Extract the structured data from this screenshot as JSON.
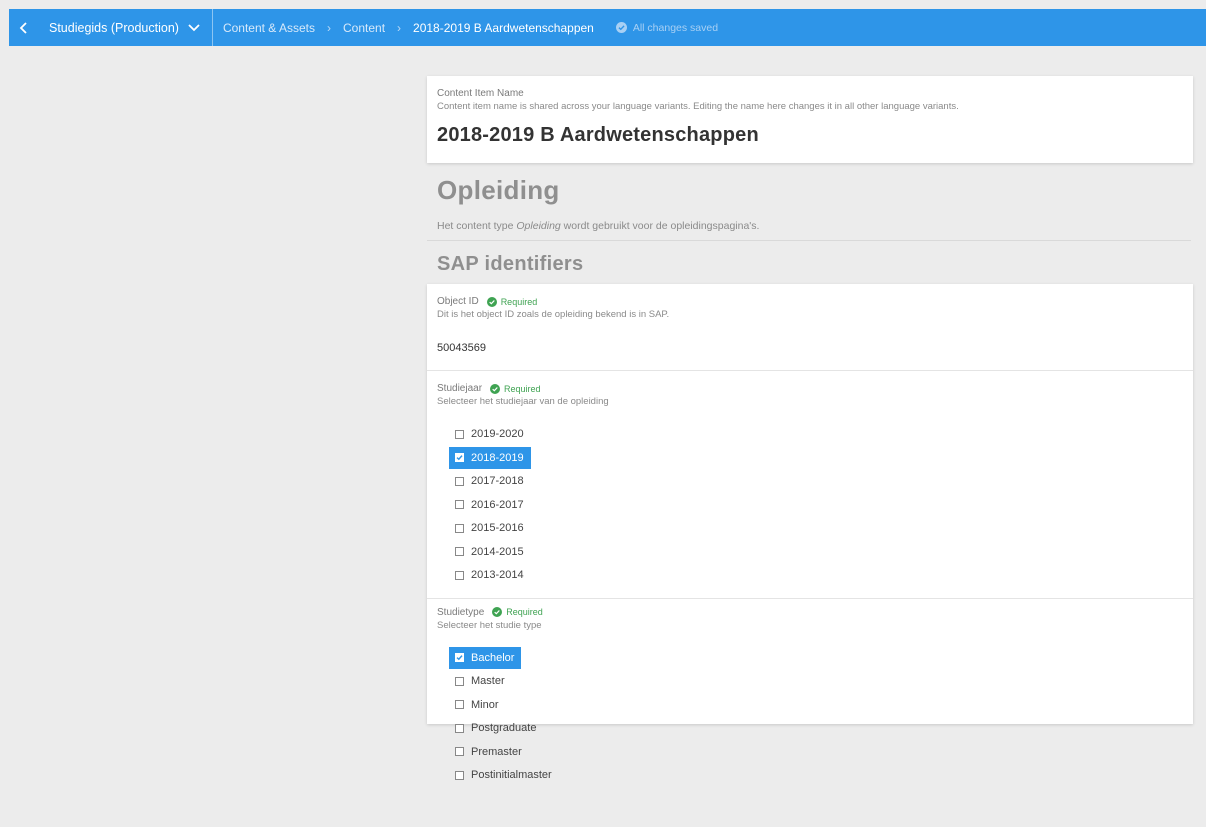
{
  "topbar": {
    "project_label": "Studiegids (Production)",
    "breadcrumbs": [
      "Content & Assets",
      "Content",
      "2018-2019 B Aardwetenschappen"
    ],
    "status": "All changes saved"
  },
  "name_card": {
    "label": "Content Item Name",
    "hint": "Content item name is shared across your language variants. Editing the name here changes it in all other language variants.",
    "value": "2018-2019 B Aardwetenschappen"
  },
  "content_type": {
    "title": "Opleiding",
    "desc_prefix": "Het content type ",
    "desc_type": "Opleiding",
    "desc_suffix": " wordt gebruikt voor de opleidingspagina's."
  },
  "group": {
    "title": "SAP identifiers"
  },
  "required_label": "Required",
  "fields": {
    "object_id": {
      "label": "Object ID",
      "hint": "Dit is het object ID zoals de opleiding bekend is in SAP.",
      "value": "50043569"
    },
    "studiejaar": {
      "label": "Studiejaar",
      "hint": "Selecteer het studiejaar van de opleiding",
      "options": [
        {
          "label": "2019-2020",
          "selected": false
        },
        {
          "label": "2018-2019",
          "selected": true
        },
        {
          "label": "2017-2018",
          "selected": false
        },
        {
          "label": "2016-2017",
          "selected": false
        },
        {
          "label": "2015-2016",
          "selected": false
        },
        {
          "label": "2014-2015",
          "selected": false
        },
        {
          "label": "2013-2014",
          "selected": false
        }
      ]
    },
    "studietype": {
      "label": "Studietype",
      "hint": "Selecteer het studie type",
      "options": [
        {
          "label": "Bachelor",
          "selected": true
        },
        {
          "label": "Master",
          "selected": false
        },
        {
          "label": "Minor",
          "selected": false
        },
        {
          "label": "Postgraduate",
          "selected": false
        },
        {
          "label": "Premaster",
          "selected": false
        },
        {
          "label": "Postinitialmaster",
          "selected": false
        }
      ]
    }
  },
  "colors": {
    "accent": "#2e95e8",
    "required": "#3fa352",
    "background": "#ececec"
  }
}
